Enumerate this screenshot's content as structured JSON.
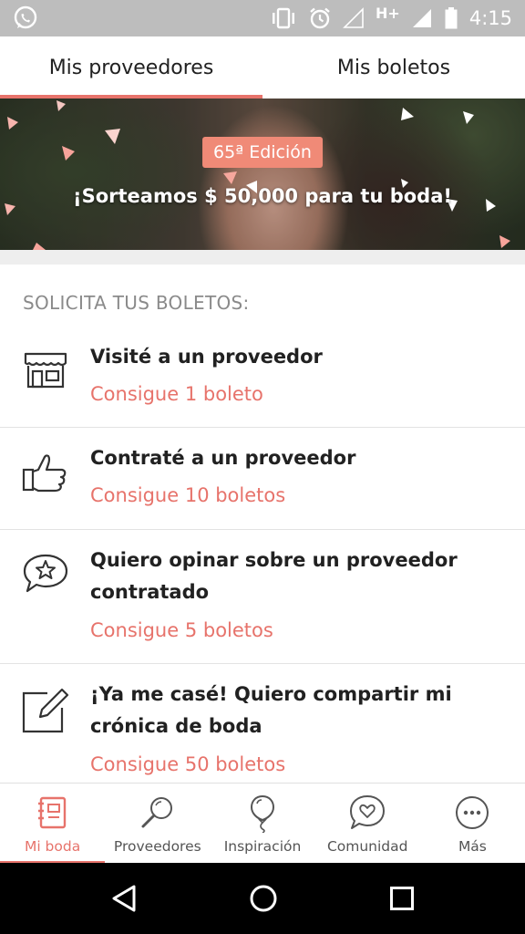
{
  "status_bar": {
    "time": "4:15",
    "network_type": "H+",
    "icons": [
      "whatsapp-icon",
      "vibrate-icon",
      "alarm-icon",
      "signal-empty-icon",
      "signal-full-icon",
      "battery-icon"
    ]
  },
  "tabs": [
    {
      "label": "Mis proveedores",
      "active": true
    },
    {
      "label": "Mis boletos",
      "active": false
    }
  ],
  "banner": {
    "edition": "65ª Edición",
    "title": "¡Sorteamos $ 50,000 para tu boda!"
  },
  "section_title": "SOLICITA TUS BOLETOS:",
  "items": [
    {
      "title": "Visité a un proveedor",
      "reward": "Consigue 1 boleto",
      "icon": "store-icon"
    },
    {
      "title": "Contraté a un proveedor",
      "reward": "Consigue 10 boletos",
      "icon": "thumbs-up-icon"
    },
    {
      "title": "Quiero opinar sobre un proveedor contratado",
      "reward": "Consigue 5 boletos",
      "icon": "star-chat-icon"
    },
    {
      "title": "¡Ya me casé! Quiero compartir mi crónica de boda",
      "reward": "Consigue 50 boletos",
      "icon": "edit-icon"
    }
  ],
  "bottom_nav": [
    {
      "label": "Mi boda",
      "icon": "notebook-icon",
      "active": true
    },
    {
      "label": "Proveedores",
      "icon": "search-icon",
      "active": false
    },
    {
      "label": "Inspiración",
      "icon": "balloon-icon",
      "active": false
    },
    {
      "label": "Comunidad",
      "icon": "heart-chat-icon",
      "active": false
    },
    {
      "label": "Más",
      "icon": "more-icon",
      "active": false
    }
  ],
  "colors": {
    "accent": "#e7736b",
    "badge": "#f08a77",
    "status_bar": "#bdbdbd"
  }
}
